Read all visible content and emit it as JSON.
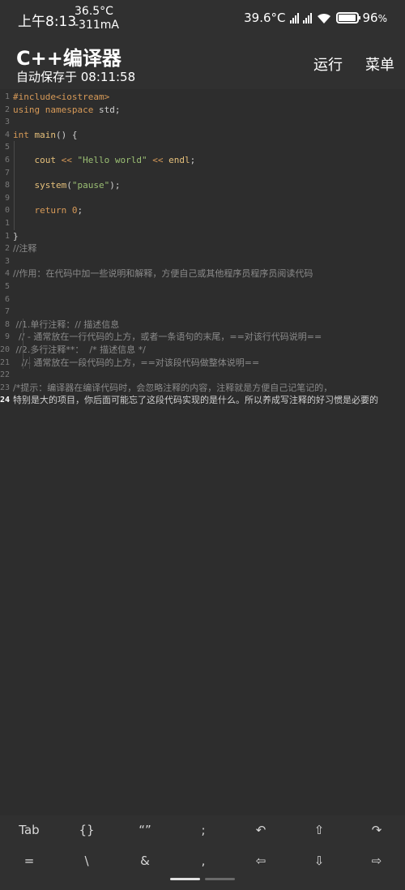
{
  "status": {
    "time": "上午8:13",
    "temp": "36.5°C",
    "current": "-311mA",
    "right_temp": "39.6°C",
    "battery": "96",
    "battery_unit": "%",
    "battery_level": 0.96
  },
  "app": {
    "title": "C++编译器",
    "saved": "自动保存于 08:11:58",
    "run": "运行",
    "menu": "菜单"
  },
  "editor": {
    "lines": [
      {
        "n": "1",
        "text": "#include<iostream>"
      },
      {
        "n": "2",
        "text": "using namespace std;"
      },
      {
        "n": "3",
        "text": ""
      },
      {
        "n": "4",
        "text": "int main() {"
      },
      {
        "n": "5",
        "text": ""
      },
      {
        "n": "6",
        "text": "    cout << \"Hello world\" << endl;"
      },
      {
        "n": "7",
        "text": ""
      },
      {
        "n": "8",
        "text": "    system(\"pause\");"
      },
      {
        "n": "9",
        "text": ""
      },
      {
        "n": "0",
        "text": "    return 0;"
      },
      {
        "n": "1",
        "text": ""
      },
      {
        "n": "1",
        "text": "}"
      },
      {
        "n": "2",
        "text": "//注释"
      },
      {
        "n": "3",
        "text": ""
      },
      {
        "n": "4",
        "text": "//作用：在代码中加一些说明和解释，方便自己或其他程序员程序员阅读代码"
      },
      {
        "n": "5",
        "text": ""
      },
      {
        "n": "6",
        "text": ""
      },
      {
        "n": "7",
        "text": ""
      },
      {
        "n": "8",
        "text": " //1.单行注释：// 描述信息"
      },
      {
        "n": "9",
        "text": "  // - 通常放在一行代码的上方，或者一条语句的末尾，==对该行代码说明=="
      },
      {
        "n": "20",
        "text": " //2.多行注释**：  /* 描述信息 */"
      },
      {
        "n": "21",
        "text": "   //- 通常放在一段代码的上方，==对该段代码做整体说明=="
      },
      {
        "n": "22",
        "text": ""
      },
      {
        "n": "23",
        "text": "/*提示：编译器在编译代码时，会忽略注释的内容，注释就是方便自己记笔记的，"
      },
      {
        "n": "24",
        "text": "特别是大的项目，你后面可能忘了这段代码实现的是什么。所以养成写注释的好习惯是必要的"
      }
    ]
  },
  "toolbar": {
    "row1": [
      "Tab",
      "{}",
      "“”",
      ";",
      "↶",
      "⇧",
      "↷"
    ],
    "row2": [
      "=",
      "\\",
      "&",
      ",",
      "⇦",
      "⇩",
      "⇨"
    ]
  }
}
